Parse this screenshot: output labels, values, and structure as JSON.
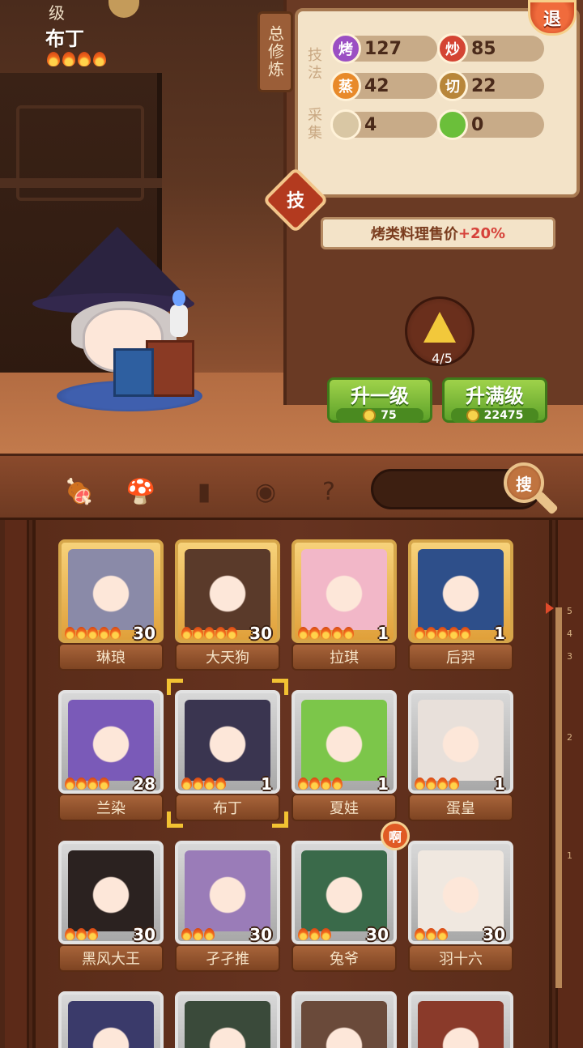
{
  "character": {
    "level_label": "级",
    "name": "布丁",
    "stars": 4
  },
  "panel": {
    "skill_tag": "总修炼",
    "exit_label": "退",
    "technique_label": "技法",
    "gather_label": "采集",
    "stats": [
      {
        "icon_text": "烤",
        "value": "127",
        "color": "#9b4fc3"
      },
      {
        "icon_text": "炒",
        "value": "85",
        "color": "#d44433"
      },
      {
        "icon_text": "蒸",
        "value": "42",
        "color": "#e88a2a"
      },
      {
        "icon_text": "切",
        "value": "22",
        "color": "#b8863a"
      },
      {
        "icon_text": "",
        "value": "4",
        "color": "#d9c7a4",
        "icon": "bread-icon"
      },
      {
        "icon_text": "",
        "value": "0",
        "color": "#6bbf3a",
        "icon": "cabbage-icon"
      }
    ],
    "skill_badge": "技",
    "bonus_text": "烤类料理售价",
    "bonus_value": "+20%",
    "item_count": "4/5",
    "upgrade_one": {
      "label": "升一级",
      "cost": "75"
    },
    "upgrade_max": {
      "label": "升满级",
      "cost": "22475"
    }
  },
  "toolbar": {
    "search_label": "搜",
    "tools": [
      "meat-filter-icon",
      "mushroom-filter-icon",
      "jar-filter-icon",
      "location-filter-icon",
      "map-question-icon"
    ]
  },
  "scale": [
    "5",
    "4",
    "3",
    "2",
    "1"
  ],
  "roster": [
    {
      "name": "琳琅",
      "level": "30",
      "stars": 5,
      "frame": "gold",
      "tint": "#8a8aa8"
    },
    {
      "name": "大天狗",
      "level": "30",
      "stars": 5,
      "frame": "gold",
      "tint": "#5a3a2a"
    },
    {
      "name": "拉琪",
      "level": "1",
      "stars": 5,
      "frame": "gold",
      "tint": "#f2b7c8"
    },
    {
      "name": "后羿",
      "level": "1",
      "stars": 5,
      "frame": "gold",
      "tint": "#2e4f8a"
    },
    {
      "name": "兰染",
      "level": "28",
      "stars": 4,
      "frame": "silver",
      "tint": "#7a5ab8"
    },
    {
      "name": "布丁",
      "level": "1",
      "stars": 4,
      "frame": "silver",
      "tint": "#3a3550",
      "selected": true
    },
    {
      "name": "夏娃",
      "level": "1",
      "stars": 4,
      "frame": "silver",
      "tint": "#7cc64a"
    },
    {
      "name": "蛋皇",
      "level": "1",
      "stars": 4,
      "frame": "silver",
      "tint": "#e8e0da"
    },
    {
      "name": "黑风大王",
      "level": "30",
      "stars": 3,
      "frame": "silver",
      "tint": "#2b2220"
    },
    {
      "name": "孑孑推",
      "level": "30",
      "stars": 3,
      "frame": "silver",
      "tint": "#9a7cb8"
    },
    {
      "name": "兔爷",
      "level": "30",
      "stars": 3,
      "frame": "silver",
      "tint": "#3a6a4a",
      "badge": "啊"
    },
    {
      "name": "羽十六",
      "level": "30",
      "stars": 3,
      "frame": "silver",
      "tint": "#f0e8e0"
    },
    {
      "name": "",
      "level": "",
      "stars": 0,
      "frame": "silver",
      "tint": "#3a3a6a"
    },
    {
      "name": "",
      "level": "",
      "stars": 0,
      "frame": "silver",
      "tint": "#3a4a3a"
    },
    {
      "name": "",
      "level": "",
      "stars": 0,
      "frame": "silver",
      "tint": "#6a4a3a"
    },
    {
      "name": "",
      "level": "",
      "stars": 0,
      "frame": "silver",
      "tint": "#8a3a2a"
    }
  ]
}
